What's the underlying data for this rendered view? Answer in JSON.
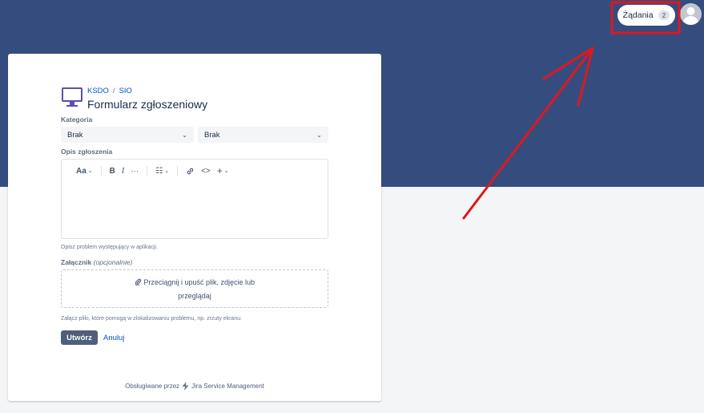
{
  "header": {
    "requests_label": "Żądania",
    "requests_count": "2"
  },
  "form": {
    "breadcrumb": [
      "KSDO",
      "SIO"
    ],
    "breadcrumb_sep": "/",
    "title": "Formularz zgłoszeniowy",
    "category_label": "Kategoria",
    "category_select_1": "Brak",
    "category_select_2": "Brak",
    "description_label": "Opis zgłoszenia",
    "toolbar": {
      "text_style": "Aa",
      "bold": "B",
      "italic": "I",
      "more": "···",
      "list": "☷",
      "code": "<>",
      "insert": "+"
    },
    "description_help": "Opisz problem występujący w aplikacji.",
    "attachment_label": "Załącznik",
    "attachment_optional": "(opcjonalnie)",
    "dropzone_line1": "Przeciągnij i upuść plik, zdjęcie lub",
    "dropzone_line2": "przeglądaj",
    "attachment_help": "Załącz pliki, które pomogą w zlokalizowaniu problemu, np. zrzuty ekranu.",
    "create_button": "Utwórz",
    "cancel_button": "Anuluj"
  },
  "footer": {
    "powered_by": "Obsługiwane przez",
    "product": "Jira Service Management"
  },
  "colors": {
    "hero": "#344d7e",
    "annotation": "#e0161f",
    "link": "#0052cc"
  }
}
